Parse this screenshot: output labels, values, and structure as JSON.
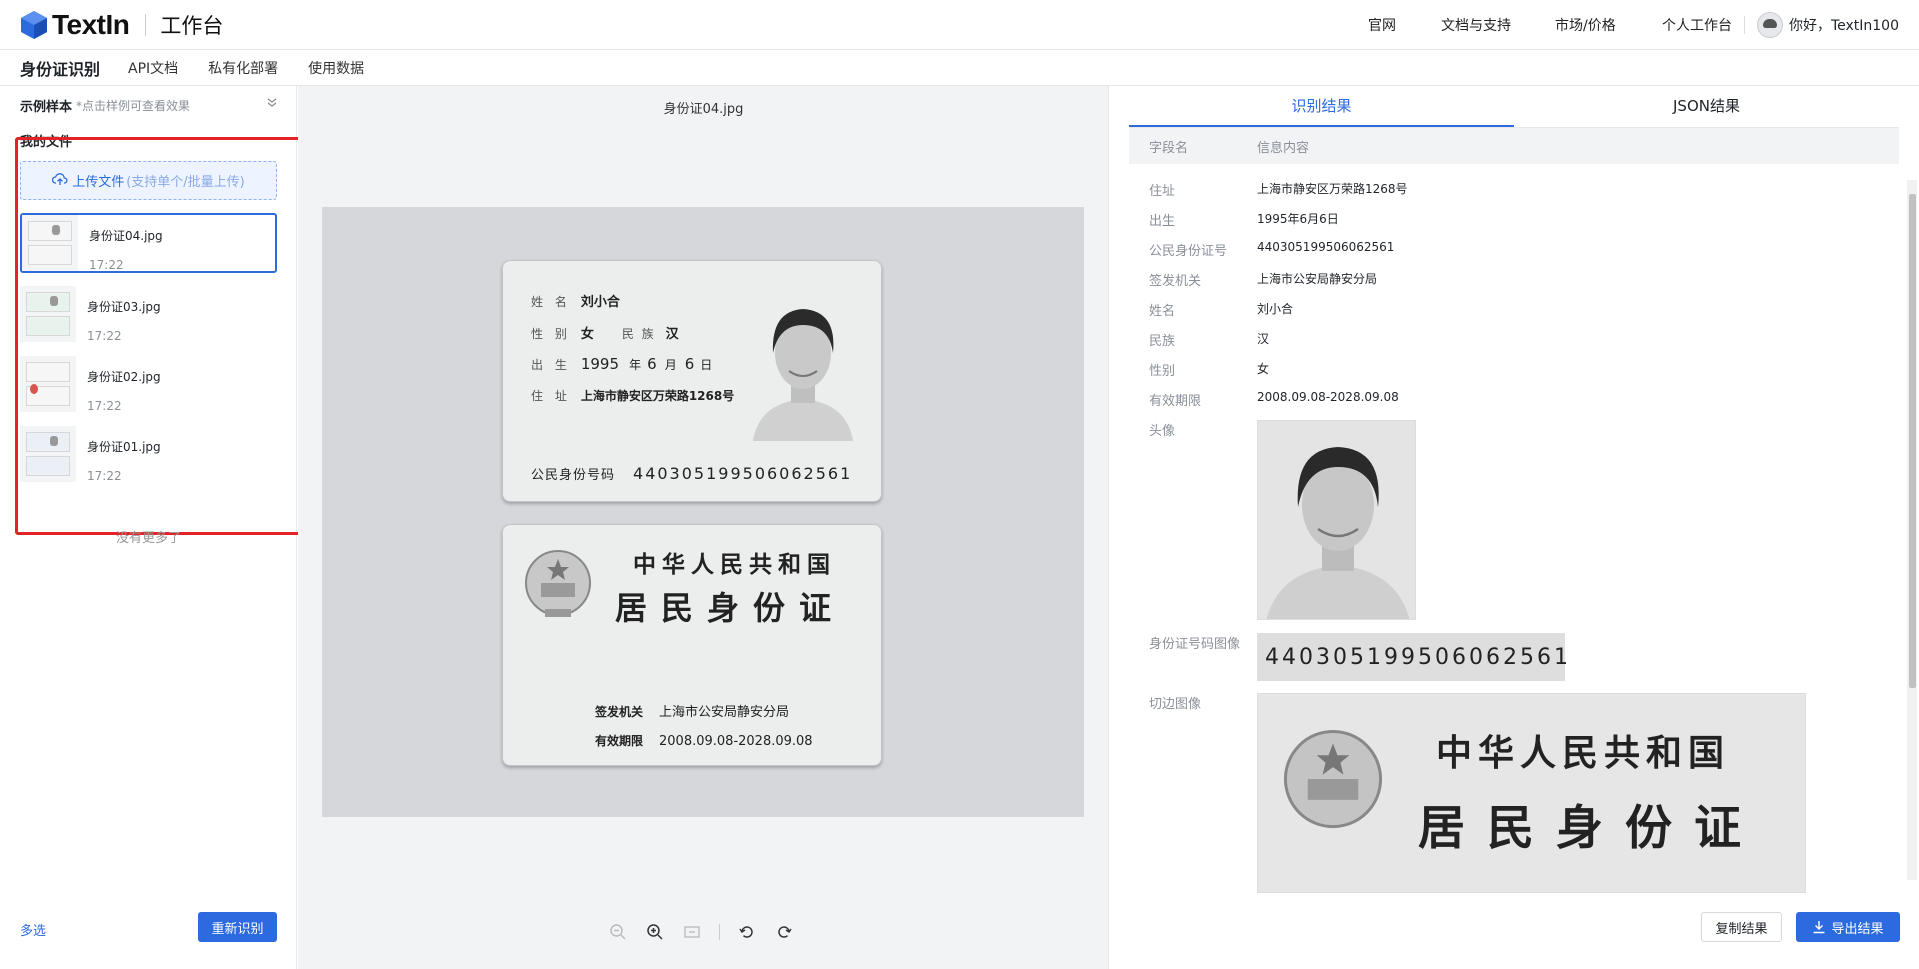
{
  "brand": {
    "name": "TextIn",
    "sub": "工作台"
  },
  "topnav": [
    "官网",
    "文档与支持",
    "市场/价格",
    "个人工作台"
  ],
  "user": {
    "greeting": "你好，TextIn100"
  },
  "subnav": {
    "active": "身份证识别",
    "tabs": [
      "API文档",
      "私有化部署",
      "使用数据"
    ]
  },
  "left": {
    "sample_title": "示例样本",
    "sample_hint": "*点击样例可查看效果",
    "myfiles_title": "我的文件",
    "upload_label": "上传文件",
    "upload_hint": "(支持单个/批量上传)",
    "files": [
      {
        "name": "身份证04.jpg",
        "time": "17:22",
        "selected": true
      },
      {
        "name": "身份证03.jpg",
        "time": "17:22",
        "selected": false
      },
      {
        "name": "身份证02.jpg",
        "time": "17:22",
        "selected": false
      },
      {
        "name": "身份证01.jpg",
        "time": "17:22",
        "selected": false
      }
    ],
    "no_more": "没有更多了",
    "multi_select": "多选",
    "reidentify": "重新识别"
  },
  "center": {
    "image_title": "身份证04.jpg",
    "front": {
      "name_label": "姓 名",
      "name": "刘小合",
      "sex_label": "性 别",
      "sex": "女",
      "ethnic_label": "民 族",
      "ethnic": "汉",
      "birth_label": "出 生",
      "birth_y": "1995",
      "y": "年",
      "birth_m": "6",
      "m": "月",
      "birth_d": "6",
      "d": "日",
      "addr_label": "住 址",
      "addr": "上海市静安区万荣路1268号",
      "idnum_label": "公民身份号码",
      "idnum": "440305199506062561"
    },
    "back": {
      "title1": "中华人民共和国",
      "title2": "居民身份证",
      "issuer_label": "签发机关",
      "issuer": "上海市公安局静安分局",
      "valid_label": "有效期限",
      "valid": "2008.09.08-2028.09.08"
    }
  },
  "right": {
    "tabs": [
      "识别结果",
      "JSON结果"
    ],
    "col_field": "字段名",
    "col_value": "信息内容",
    "rows": [
      {
        "k": "住址",
        "v": "上海市静安区万荣路1268号"
      },
      {
        "k": "出生",
        "v": "1995年6月6日"
      },
      {
        "k": "公民身份证号",
        "v": "440305199506062561"
      },
      {
        "k": "签发机关",
        "v": "上海市公安局静安分局"
      },
      {
        "k": "姓名",
        "v": "刘小合"
      },
      {
        "k": "民族",
        "v": "汉"
      },
      {
        "k": "性别",
        "v": "女"
      },
      {
        "k": "有效期限",
        "v": "2008.09.08-2028.09.08"
      }
    ],
    "avatar_label": "头像",
    "idimg_label": "身份证号码图像",
    "idimg_text": "440305199506062561",
    "crop_label": "切边图像",
    "crop_t1": "中华人民共和国",
    "crop_t2": "居民身份证",
    "copy": "复制结果",
    "export": "导出结果"
  },
  "colors": {
    "accent": "#2c6bdf",
    "highlight_box": "#e3222a"
  }
}
